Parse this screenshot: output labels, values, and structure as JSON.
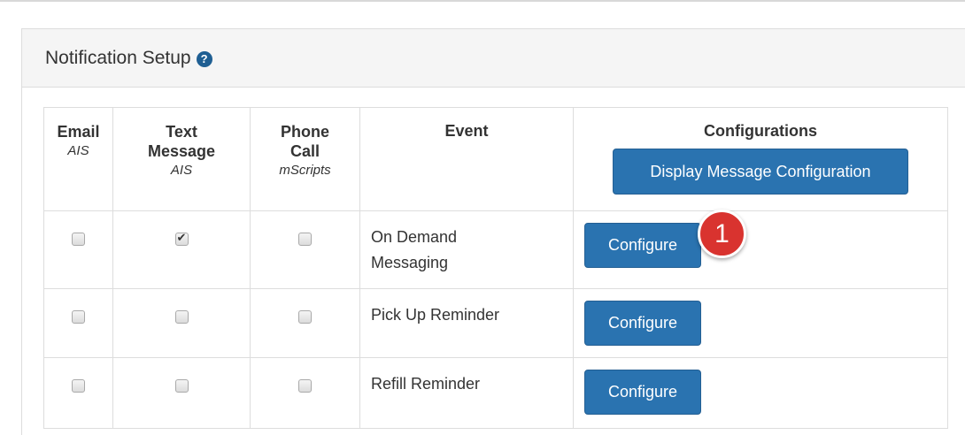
{
  "panel": {
    "title": "Notification Setup",
    "help_icon": "question-circle-icon"
  },
  "table": {
    "headers": {
      "email": {
        "line1": "Email",
        "sub": "AIS"
      },
      "text": {
        "line1": "Text",
        "line2": "Message",
        "sub": "AIS"
      },
      "phone": {
        "line1": "Phone",
        "line2": "Call",
        "sub": "mScripts"
      },
      "event": "Event",
      "configurations": "Configurations"
    },
    "display_button": "Display Message Configuration",
    "rows": [
      {
        "email": false,
        "text": true,
        "phone": false,
        "event_line1": "On Demand",
        "event_line2": "Messaging",
        "button": "Configure"
      },
      {
        "email": false,
        "text": false,
        "phone": false,
        "event_line1": "Pick Up Reminder",
        "event_line2": "",
        "button": "Configure"
      },
      {
        "email": false,
        "text": false,
        "phone": false,
        "event_line1": "Refill Reminder",
        "event_line2": "",
        "button": "Configure"
      }
    ]
  },
  "callout": {
    "number": "1",
    "color": "#d9332f"
  },
  "colors": {
    "button": "#2a73b0",
    "help_icon": "#1f5f93",
    "heading_bg": "#f5f5f5"
  }
}
